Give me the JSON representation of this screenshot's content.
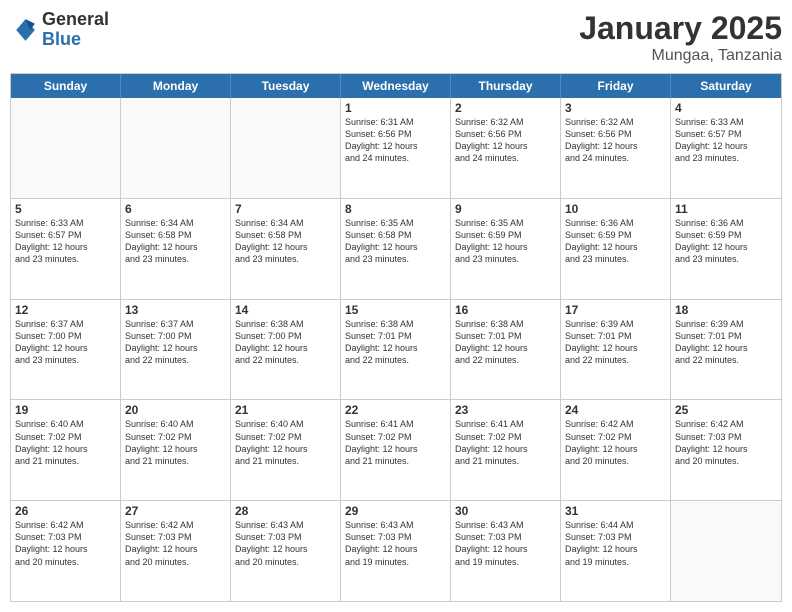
{
  "logo": {
    "general": "General",
    "blue": "Blue"
  },
  "header": {
    "month": "January 2025",
    "location": "Mungaa, Tanzania"
  },
  "weekdays": [
    "Sunday",
    "Monday",
    "Tuesday",
    "Wednesday",
    "Thursday",
    "Friday",
    "Saturday"
  ],
  "rows": [
    [
      {
        "day": "",
        "info": ""
      },
      {
        "day": "",
        "info": ""
      },
      {
        "day": "",
        "info": ""
      },
      {
        "day": "1",
        "info": "Sunrise: 6:31 AM\nSunset: 6:56 PM\nDaylight: 12 hours\nand 24 minutes."
      },
      {
        "day": "2",
        "info": "Sunrise: 6:32 AM\nSunset: 6:56 PM\nDaylight: 12 hours\nand 24 minutes."
      },
      {
        "day": "3",
        "info": "Sunrise: 6:32 AM\nSunset: 6:56 PM\nDaylight: 12 hours\nand 24 minutes."
      },
      {
        "day": "4",
        "info": "Sunrise: 6:33 AM\nSunset: 6:57 PM\nDaylight: 12 hours\nand 23 minutes."
      }
    ],
    [
      {
        "day": "5",
        "info": "Sunrise: 6:33 AM\nSunset: 6:57 PM\nDaylight: 12 hours\nand 23 minutes."
      },
      {
        "day": "6",
        "info": "Sunrise: 6:34 AM\nSunset: 6:58 PM\nDaylight: 12 hours\nand 23 minutes."
      },
      {
        "day": "7",
        "info": "Sunrise: 6:34 AM\nSunset: 6:58 PM\nDaylight: 12 hours\nand 23 minutes."
      },
      {
        "day": "8",
        "info": "Sunrise: 6:35 AM\nSunset: 6:58 PM\nDaylight: 12 hours\nand 23 minutes."
      },
      {
        "day": "9",
        "info": "Sunrise: 6:35 AM\nSunset: 6:59 PM\nDaylight: 12 hours\nand 23 minutes."
      },
      {
        "day": "10",
        "info": "Sunrise: 6:36 AM\nSunset: 6:59 PM\nDaylight: 12 hours\nand 23 minutes."
      },
      {
        "day": "11",
        "info": "Sunrise: 6:36 AM\nSunset: 6:59 PM\nDaylight: 12 hours\nand 23 minutes."
      }
    ],
    [
      {
        "day": "12",
        "info": "Sunrise: 6:37 AM\nSunset: 7:00 PM\nDaylight: 12 hours\nand 23 minutes."
      },
      {
        "day": "13",
        "info": "Sunrise: 6:37 AM\nSunset: 7:00 PM\nDaylight: 12 hours\nand 22 minutes."
      },
      {
        "day": "14",
        "info": "Sunrise: 6:38 AM\nSunset: 7:00 PM\nDaylight: 12 hours\nand 22 minutes."
      },
      {
        "day": "15",
        "info": "Sunrise: 6:38 AM\nSunset: 7:01 PM\nDaylight: 12 hours\nand 22 minutes."
      },
      {
        "day": "16",
        "info": "Sunrise: 6:38 AM\nSunset: 7:01 PM\nDaylight: 12 hours\nand 22 minutes."
      },
      {
        "day": "17",
        "info": "Sunrise: 6:39 AM\nSunset: 7:01 PM\nDaylight: 12 hours\nand 22 minutes."
      },
      {
        "day": "18",
        "info": "Sunrise: 6:39 AM\nSunset: 7:01 PM\nDaylight: 12 hours\nand 22 minutes."
      }
    ],
    [
      {
        "day": "19",
        "info": "Sunrise: 6:40 AM\nSunset: 7:02 PM\nDaylight: 12 hours\nand 21 minutes."
      },
      {
        "day": "20",
        "info": "Sunrise: 6:40 AM\nSunset: 7:02 PM\nDaylight: 12 hours\nand 21 minutes."
      },
      {
        "day": "21",
        "info": "Sunrise: 6:40 AM\nSunset: 7:02 PM\nDaylight: 12 hours\nand 21 minutes."
      },
      {
        "day": "22",
        "info": "Sunrise: 6:41 AM\nSunset: 7:02 PM\nDaylight: 12 hours\nand 21 minutes."
      },
      {
        "day": "23",
        "info": "Sunrise: 6:41 AM\nSunset: 7:02 PM\nDaylight: 12 hours\nand 21 minutes."
      },
      {
        "day": "24",
        "info": "Sunrise: 6:42 AM\nSunset: 7:02 PM\nDaylight: 12 hours\nand 20 minutes."
      },
      {
        "day": "25",
        "info": "Sunrise: 6:42 AM\nSunset: 7:03 PM\nDaylight: 12 hours\nand 20 minutes."
      }
    ],
    [
      {
        "day": "26",
        "info": "Sunrise: 6:42 AM\nSunset: 7:03 PM\nDaylight: 12 hours\nand 20 minutes."
      },
      {
        "day": "27",
        "info": "Sunrise: 6:42 AM\nSunset: 7:03 PM\nDaylight: 12 hours\nand 20 minutes."
      },
      {
        "day": "28",
        "info": "Sunrise: 6:43 AM\nSunset: 7:03 PM\nDaylight: 12 hours\nand 20 minutes."
      },
      {
        "day": "29",
        "info": "Sunrise: 6:43 AM\nSunset: 7:03 PM\nDaylight: 12 hours\nand 19 minutes."
      },
      {
        "day": "30",
        "info": "Sunrise: 6:43 AM\nSunset: 7:03 PM\nDaylight: 12 hours\nand 19 minutes."
      },
      {
        "day": "31",
        "info": "Sunrise: 6:44 AM\nSunset: 7:03 PM\nDaylight: 12 hours\nand 19 minutes."
      },
      {
        "day": "",
        "info": ""
      }
    ]
  ]
}
